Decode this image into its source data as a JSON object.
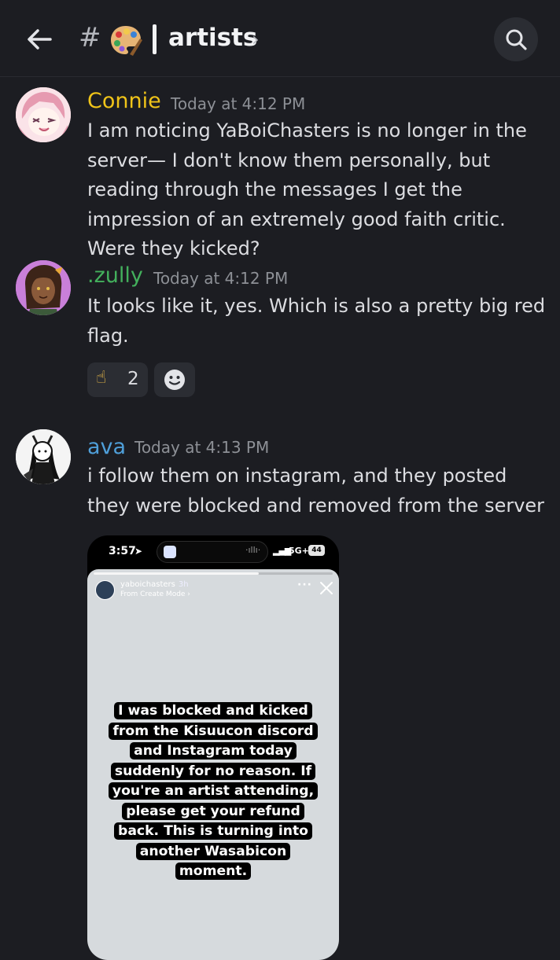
{
  "header": {
    "hash": "#",
    "channel_emoji": "palette-icon",
    "channel_name": "artists",
    "chevron": "›"
  },
  "messages": [
    {
      "author": "Connie",
      "author_color": "#f0c419",
      "timestamp": "Today at 4:12 PM",
      "text": "I am noticing YaBoiChasters is no longer in the server— I don't know them personally, but reading through the messages I get the impression of an extremely good faith critic. Were they kicked?"
    },
    {
      "author": ".zully",
      "author_color": "#43b05c",
      "timestamp": "Today at 4:12 PM",
      "text": "It looks like it, yes. Which is also a pretty big red flag.",
      "reactions": [
        {
          "emoji": "☝",
          "count": "2"
        }
      ]
    },
    {
      "author": "ava",
      "author_color": "#4f9fd9",
      "timestamp": "Today at 4:13 PM",
      "text": "i follow them on instagram, and they posted they were blocked and removed from the server"
    }
  ],
  "attachment": {
    "status_time": "3:57",
    "network": "5G+",
    "battery": "44",
    "story_user": "yaboichasters",
    "story_age": "3h",
    "story_sub": "From Create Mode ›",
    "story_text": "I was blocked and kicked from the Kisuucon discord and Instagram today suddenly for no reason.  If you're an artist attending, please get your refund back. This is turning into another Wasabicon moment.",
    "story_progress": 0.69
  }
}
